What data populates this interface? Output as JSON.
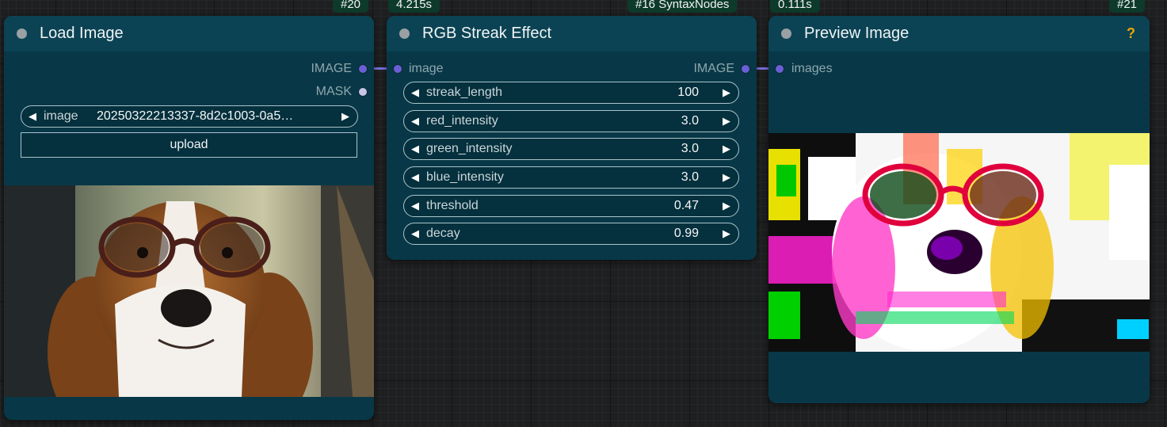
{
  "badges": {
    "load_id": "#20",
    "rgb_time": "4.215s",
    "rgb_id": "#16 SyntaxNodes",
    "preview_time": "0.111s",
    "preview_id": "#21"
  },
  "load_node": {
    "title": "Load Image",
    "outputs": [
      "IMAGE",
      "MASK"
    ],
    "image_widget": {
      "name": "image",
      "value": "20250322213337-8d2c1003-0a5…"
    },
    "upload_label": "upload"
  },
  "rgb_node": {
    "title": "RGB Streak Effect",
    "input": "image",
    "output": "IMAGE",
    "widgets": [
      {
        "name": "streak_length",
        "value": "100"
      },
      {
        "name": "red_intensity",
        "value": "3.0"
      },
      {
        "name": "green_intensity",
        "value": "3.0"
      },
      {
        "name": "blue_intensity",
        "value": "3.0"
      },
      {
        "name": "threshold",
        "value": "0.47"
      },
      {
        "name": "decay",
        "value": "0.99"
      }
    ]
  },
  "preview_node": {
    "title": "Preview Image",
    "input": "images",
    "help": "?"
  },
  "icons": {
    "left": "◀",
    "right": "▶"
  }
}
